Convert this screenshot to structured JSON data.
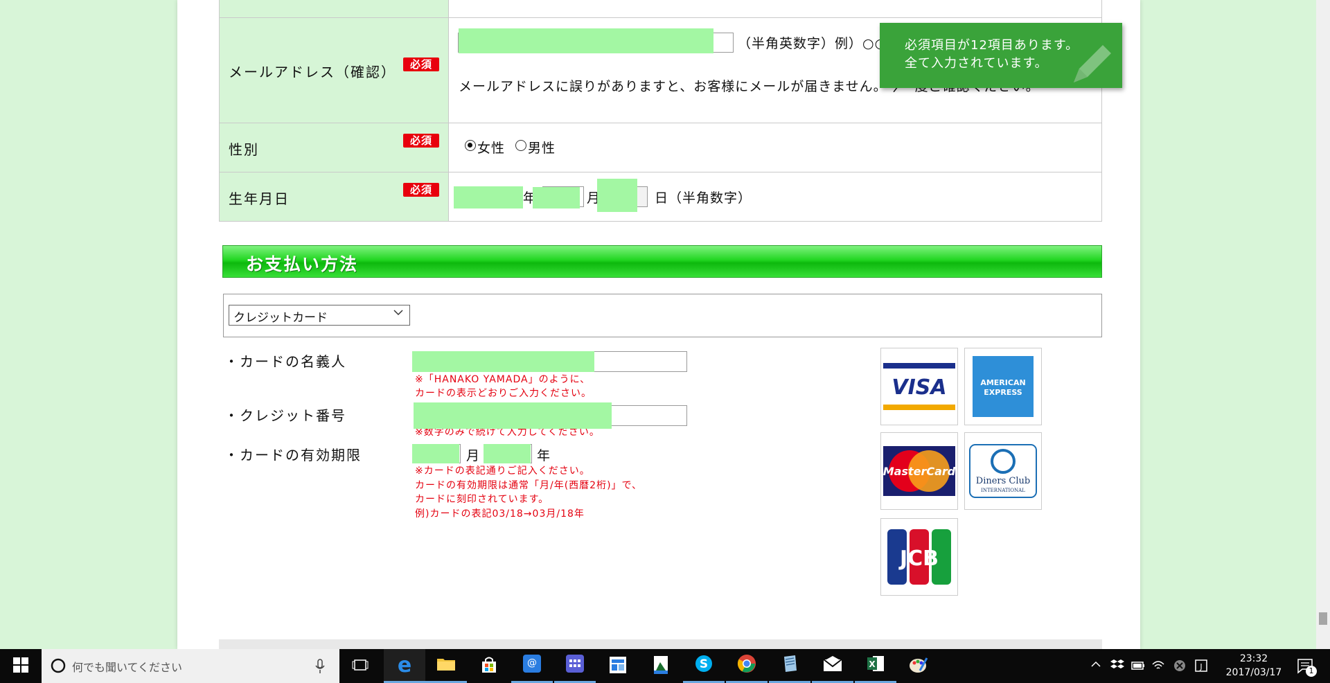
{
  "email_confirm": {
    "label": "メールアドレス（確認）",
    "required": "必須",
    "format_hint": "（半角英数字）例）○○○○",
    "note": "メールアドレスに誤りがありますと、お客様にメールが届きません。今一度ご確認ください。"
  },
  "gender": {
    "label": "性別",
    "required": "必須",
    "options": [
      "女性",
      "男性"
    ],
    "selected": "女性"
  },
  "birthday": {
    "label": "生年月日",
    "required": "必須",
    "year_suffix": "年",
    "month_suffix": "月",
    "day_suffix": "日（半角数字）"
  },
  "payment": {
    "heading": "お支払い方法",
    "method_selected": "クレジットカード",
    "holder_label": "・カードの名義人",
    "holder_note_1": "※「HANAKO YAMADA」のように、",
    "holder_note_2": "カードの表示どおりご入力ください。",
    "number_label": "・クレジット番号",
    "number_note": "※数字のみで続けて入力してください。",
    "expiry_label": "・カードの有効期限",
    "expiry_month": "月",
    "expiry_year": "年",
    "expiry_note_1": "※カードの表記通りご記入ください。",
    "expiry_note_2": "カードの有効期限は通常「月/年(西暦2桁)」で、",
    "expiry_note_3": "カードに刻印されています。",
    "expiry_note_4": "例)カードの表記03/18→03月/18年",
    "cards": [
      "VISA",
      "AMERICAN EXPRESS",
      "MasterCard",
      "Diners Club INTERNATIONAL",
      "JCB"
    ]
  },
  "toast": {
    "line1": "必須項目が12項目あります。",
    "line2": "全て入力されています。"
  },
  "taskbar": {
    "search_placeholder": "何でも聞いてください",
    "time": "23:32",
    "date": "2017/03/17",
    "notification_count": "1",
    "apps": [
      "task-view",
      "edge",
      "file-explorer",
      "store",
      "menu-app",
      "calculator-app",
      "news-app",
      "photos-app",
      "skype",
      "chrome",
      "notepad-app",
      "mail-app",
      "excel",
      "paint-app"
    ]
  }
}
